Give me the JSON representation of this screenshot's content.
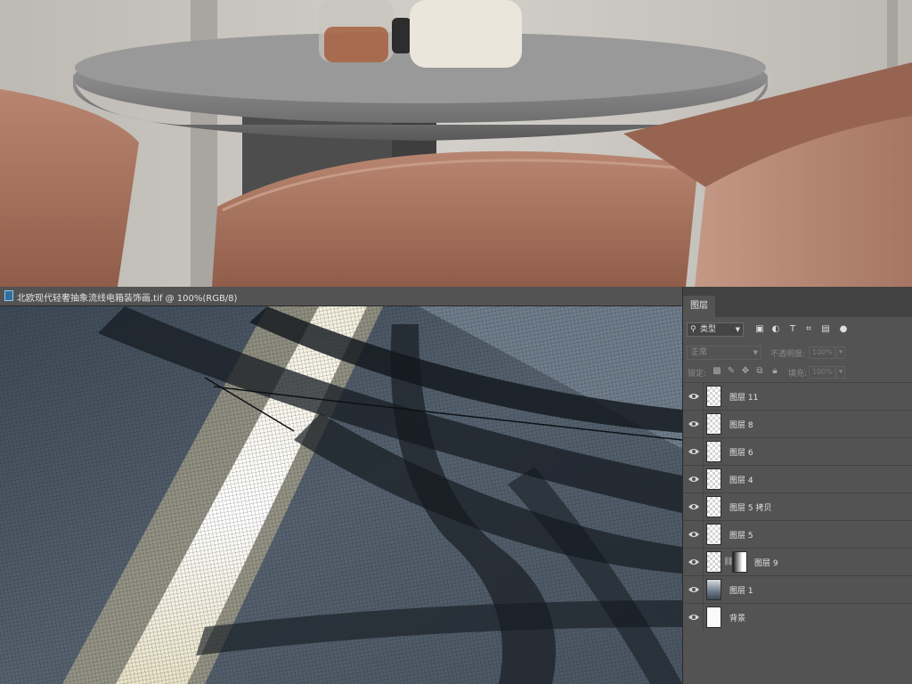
{
  "document": {
    "title": "北欧现代轻奢抽象流线电箱装饰画.tif @ 100%(RGB/8)"
  },
  "layers_panel": {
    "tab_label": "图层",
    "filter": {
      "label": "类型"
    },
    "filter_buttons": [
      "image-filter-icon",
      "adjustment-filter-icon",
      "type-filter-icon",
      "shape-filter-icon",
      "smart-object-filter-icon",
      "filter-toggle-icon"
    ],
    "blend_mode": "正常",
    "opacity_label": "不透明度:",
    "opacity_value": "100%",
    "lock_label": "锁定:",
    "fill_label": "填充:",
    "fill_value": "100%",
    "layers": [
      {
        "name": "图层 11",
        "thumb": "transparent",
        "visible": true
      },
      {
        "name": "图层 8",
        "thumb": "transparent",
        "visible": true
      },
      {
        "name": "图层 6",
        "thumb": "transparent",
        "visible": true
      },
      {
        "name": "图层 4",
        "thumb": "transparent",
        "visible": true
      },
      {
        "name": "图层 5 拷贝",
        "thumb": "transparent",
        "visible": true
      },
      {
        "name": "图层 5",
        "thumb": "transparent",
        "visible": true
      },
      {
        "name": "图层 9",
        "thumb": "transparent",
        "visible": true,
        "has_mask": true
      },
      {
        "name": "图层 1",
        "thumb": "gradient",
        "visible": true
      },
      {
        "name": "背景",
        "thumb": "white",
        "visible": true
      }
    ]
  },
  "colors": {
    "panel_bg": "#535353",
    "canvas_bg": "#4e5966",
    "chair_leather": "#a4725e",
    "table_wood": "#8f8f8f"
  }
}
